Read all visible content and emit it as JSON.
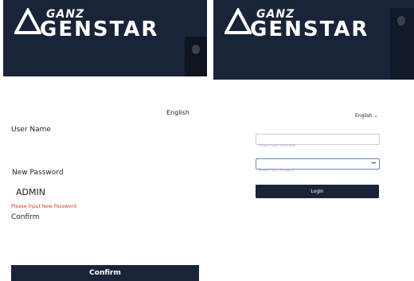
{
  "brand": {
    "top": "GANZ",
    "main": "GENSTAR"
  },
  "left": {
    "language": "English",
    "username_label": "User Name",
    "new_password_label": "New Password",
    "username_value": "ADMIN",
    "error": "Please Input New Password",
    "confirm_label": "Confirm",
    "confirm_button": "Confirm"
  },
  "right": {
    "language": "English",
    "username_placeholder": "Please Input Username",
    "password_placeholder": "Please Input Password",
    "login_button": "Login"
  }
}
